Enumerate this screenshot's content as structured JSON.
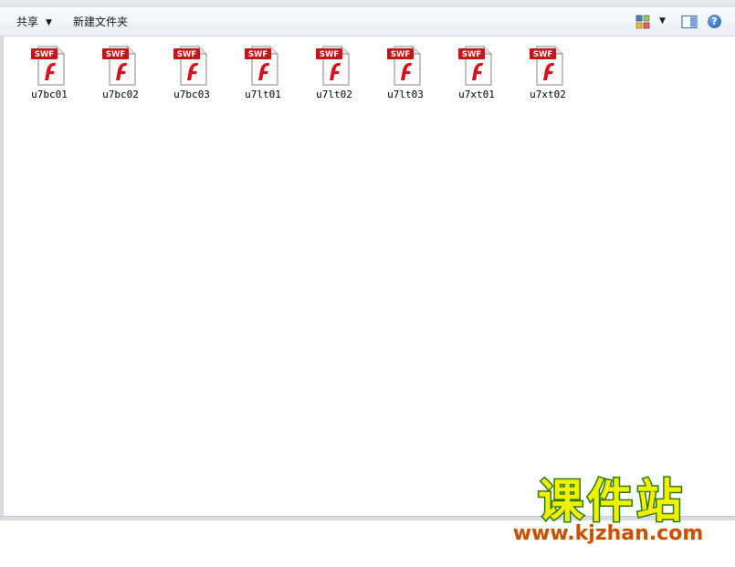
{
  "toolbar": {
    "share_label": "共享",
    "new_folder_label": "新建文件夹"
  },
  "icons": {
    "file_type": "flash-swf-icon",
    "badge_text": "SWF",
    "view": "view-options-icon",
    "preview_pane": "preview-pane-icon",
    "help": "help-icon"
  },
  "colors": {
    "swf_badge": "#c01818",
    "flash_f": "#d4141c",
    "watermark_fill": "#f2f000",
    "watermark_stroke": "#2a7a10",
    "watermark_url": "#c8500a"
  },
  "files": [
    {
      "name": "u7bc01"
    },
    {
      "name": "u7bc02"
    },
    {
      "name": "u7bc03"
    },
    {
      "name": "u7lt01"
    },
    {
      "name": "u7lt02"
    },
    {
      "name": "u7lt03"
    },
    {
      "name": "u7xt01"
    },
    {
      "name": "u7xt02"
    }
  ],
  "watermark": {
    "title": "课件站",
    "url": "www.kjzhan.com"
  }
}
